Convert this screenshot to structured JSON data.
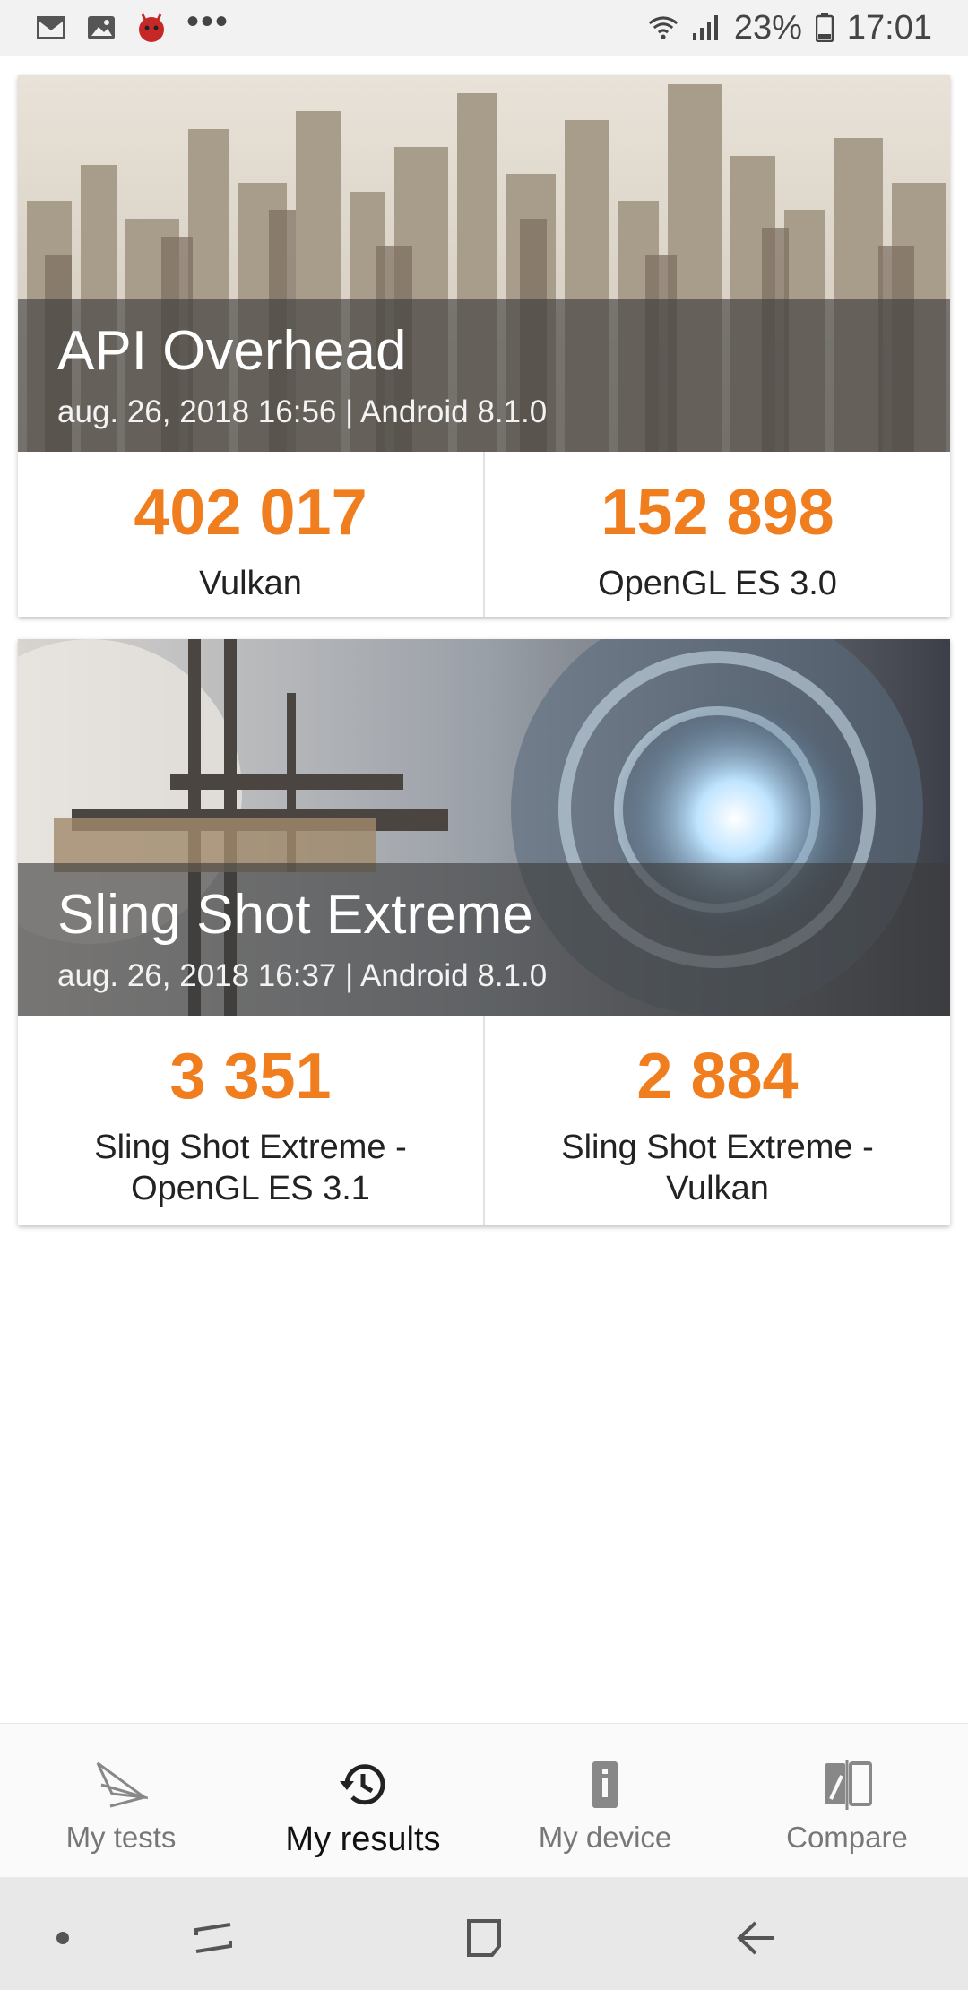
{
  "status_bar": {
    "battery": "23%",
    "time": "17:01",
    "icons": [
      "gmail-icon",
      "gallery-icon",
      "antutu-icon",
      "more-notifications-icon",
      "wifi-icon",
      "signal-icon",
      "battery-icon"
    ]
  },
  "results": [
    {
      "title": "API Overhead",
      "subtitle": "aug. 26, 2018 16:56 | Android 8.1.0",
      "scores": [
        {
          "value": "402 017",
          "label": "Vulkan"
        },
        {
          "value": "152 898",
          "label": "OpenGL ES 3.0"
        }
      ]
    },
    {
      "title": "Sling Shot Extreme",
      "subtitle": "aug. 26, 2018 16:37 | Android 8.1.0",
      "scores": [
        {
          "value": "3 351",
          "label": "Sling Shot Extreme - OpenGL ES 3.1"
        },
        {
          "value": "2 884",
          "label": "Sling Shot Extreme - Vulkan"
        }
      ]
    }
  ],
  "bottom_nav": {
    "items": [
      {
        "label": "My tests",
        "icon": "3dmark-icon"
      },
      {
        "label": "My results",
        "icon": "history-icon",
        "active": true
      },
      {
        "label": "My device",
        "icon": "device-info-icon"
      },
      {
        "label": "Compare",
        "icon": "compare-icon"
      }
    ]
  },
  "colors": {
    "accent": "#f07e1f",
    "overlay": "#3c3c3c",
    "nav_background": "#fafafa"
  }
}
